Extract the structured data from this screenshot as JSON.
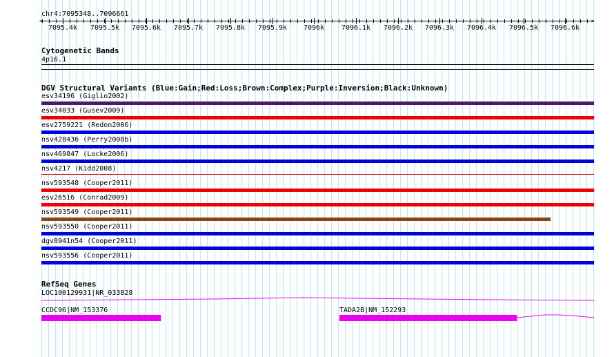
{
  "ruler": {
    "position": "chr4:7095348..7096661",
    "ticks": [
      "7095.4k",
      "7095.5k",
      "7095.6k",
      "7095.7k",
      "7095.8k",
      "7095.9k",
      "7096k",
      "7096.1k",
      "7096.2k",
      "7096.3k",
      "7096.4k",
      "7096.5k",
      "7096.6k"
    ]
  },
  "cytoband": {
    "title": "Cytogenetic Bands",
    "band": "4p16.1"
  },
  "dgv": {
    "title": "DGV Structural Variants (Blue:Gain;Red:Loss;Brown:Complex;Purple:Inversion;Black:Unknown)",
    "variants": [
      {
        "label": "esv34196 (Giglio2002)",
        "type": "Inversion",
        "color": "#4b1a6b",
        "end_fraction": 1.0
      },
      {
        "label": "esv34033 (Gusev2009)",
        "type": "Loss",
        "color": "#ee0000",
        "end_fraction": 1.0
      },
      {
        "label": "esv2759221 (Redon2006)",
        "type": "Gain",
        "color": "#0000dd",
        "end_fraction": 1.0
      },
      {
        "label": "nsv428436 (Perry2008b)",
        "type": "Gain",
        "color": "#0000dd",
        "end_fraction": 1.0
      },
      {
        "label": "nsv469847 (Locke2006)",
        "type": "Gain",
        "color": "#0000dd",
        "end_fraction": 1.0
      },
      {
        "label": "nsv4217 (Kidd2008)",
        "type": "Loss",
        "color": "#cc0000",
        "end_fraction": 1.0,
        "thin": true
      },
      {
        "label": "nsv593548 (Cooper2011)",
        "type": "Loss",
        "color": "#ee0000",
        "end_fraction": 1.0
      },
      {
        "label": "esv26516 (Conrad2009)",
        "type": "Loss",
        "color": "#ee0000",
        "end_fraction": 1.0
      },
      {
        "label": "nsv593549 (Cooper2011)",
        "type": "Complex",
        "color": "#8b4513",
        "end_fraction": 0.921
      },
      {
        "label": "nsv593550 (Cooper2011)",
        "type": "Gain",
        "color": "#0000dd",
        "end_fraction": 1.0
      },
      {
        "label": "dgv8941n54 (Cooper2011)",
        "type": "Gain",
        "color": "#0000dd",
        "end_fraction": 1.0
      },
      {
        "label": "nsv593556 (Cooper2011)",
        "type": "Gain",
        "color": "#0000dd",
        "end_fraction": 1.0
      }
    ]
  },
  "refseq": {
    "title": "RefSeq Genes",
    "genes": [
      {
        "label": "LOC100129931|NR_033828"
      },
      {
        "label": "CCDC96|NM_153376"
      },
      {
        "label": "TADA2B|NM_152293"
      }
    ],
    "color": "#ee00ee"
  }
}
